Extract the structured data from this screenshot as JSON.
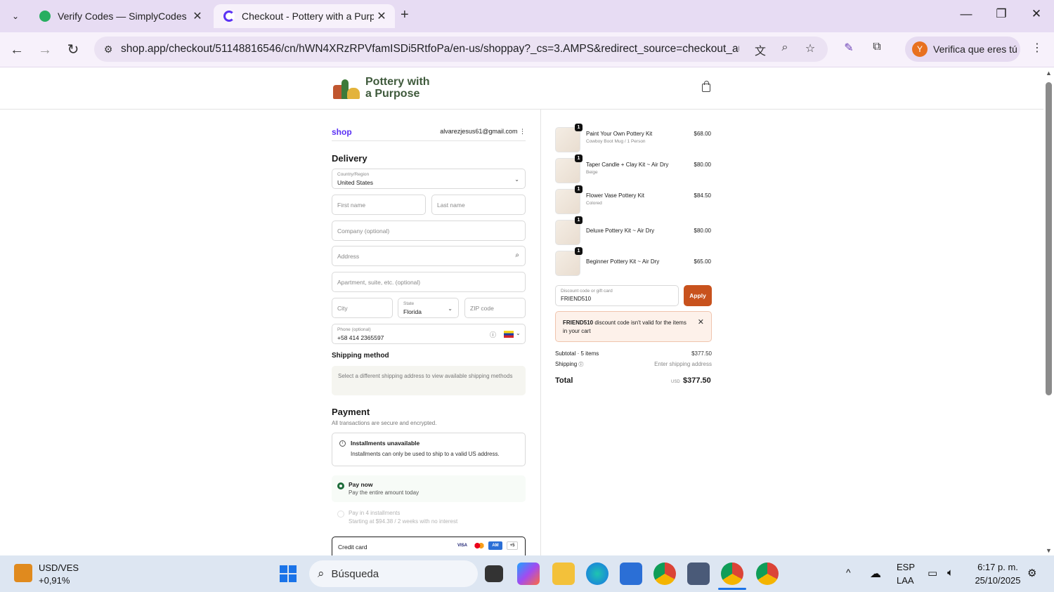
{
  "browser": {
    "tabs": [
      {
        "title": "Verify Codes — SimplyCodes",
        "active": false
      },
      {
        "title": "Checkout - Pottery with a Purpose",
        "active": true
      }
    ],
    "url": "shop.app/checkout/51148816546/cn/hWN4XRzRPVfamISDi5RtfoPa/en-us/shoppay?_cs=3.AMPS&redirect_source=checkout_aut...",
    "profile_label": "Verifica que eres tú",
    "profile_initial": "Y"
  },
  "header": {
    "logo_line1": "Pottery with",
    "logo_line2": "a Purpose"
  },
  "checkout": {
    "shop_brand": "shop",
    "email": "alvarezjesus61@gmail.com",
    "delivery_heading": "Delivery",
    "country_label": "Country/Region",
    "country_value": "United States",
    "first_name_ph": "First name",
    "last_name_ph": "Last name",
    "company_ph": "Company (optional)",
    "address_ph": "Address",
    "apartment_ph": "Apartment, suite, etc. (optional)",
    "city_ph": "City",
    "state_label": "State",
    "state_value": "Florida",
    "zip_ph": "ZIP code",
    "phone_label": "Phone (optional)",
    "phone_value": "+58 414 2365597",
    "shipping_heading": "Shipping method",
    "shipping_note": "Select a different shipping address to view available shipping methods",
    "payment_heading": "Payment",
    "payment_sub": "All transactions are secure and encrypted.",
    "installments_title": "Installments unavailable",
    "installments_text": "Installments can only be used to ship to a valid US address.",
    "pay_now_title": "Pay now",
    "pay_now_sub": "Pay the entire amount today",
    "pay4_title": "Pay in 4 installments",
    "pay4_sub": "Starting at $94.38 / 2 weeks with no interest",
    "credit_card_label": "Credit card",
    "card_more": "+5"
  },
  "summary": {
    "items": [
      {
        "qty": "1",
        "name": "Paint Your Own Pottery Kit",
        "variant": "Cowboy Boot Mug / 1 Person",
        "price": "$68.00"
      },
      {
        "qty": "1",
        "name": "Taper Candle + Clay Kit ~ Air Dry",
        "variant": "Beige",
        "price": "$80.00"
      },
      {
        "qty": "1",
        "name": "Flower Vase Pottery Kit",
        "variant": "Colored",
        "price": "$84.50"
      },
      {
        "qty": "1",
        "name": "Deluxe Pottery Kit ~ Air Dry",
        "variant": "",
        "price": "$80.00"
      },
      {
        "qty": "1",
        "name": "Beginner Pottery Kit ~ Air Dry",
        "variant": "",
        "price": "$65.00"
      }
    ],
    "discount_label": "Discount code or gift card",
    "discount_value": "FRIEND510",
    "apply_label": "Apply",
    "error_code": "FRIEND510",
    "error_text": " discount code isn't valid for the items in your cart",
    "subtotal_label": "Subtotal · 5 items",
    "subtotal_value": "$377.50",
    "shipping_label": "Shipping",
    "shipping_value": "Enter shipping address",
    "total_label": "Total",
    "total_currency": "USD",
    "total_value": "$377.50"
  },
  "taskbar": {
    "widget_title": "USD/VES",
    "widget_value": "+0,91%",
    "search_placeholder": "Búsqueda",
    "lang1": "ESP",
    "lang2": "LAA",
    "time": "6:17 p. m.",
    "date": "25/10/2025"
  }
}
